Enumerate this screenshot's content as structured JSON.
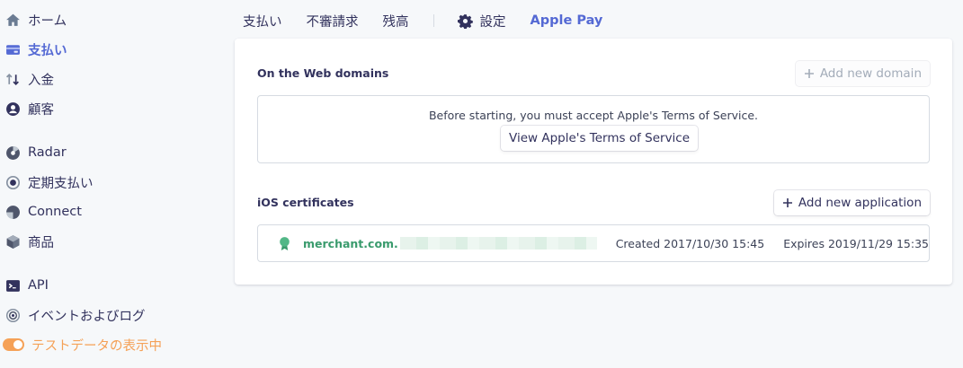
{
  "sidebar": {
    "items": [
      {
        "label": "ホーム",
        "icon": "home-icon"
      },
      {
        "label": "支払い",
        "icon": "payments-icon",
        "active": true
      },
      {
        "label": "入金",
        "icon": "transfer-icon"
      },
      {
        "label": "顧客",
        "icon": "customer-icon"
      },
      {
        "label": "Radar",
        "icon": "radar-icon"
      },
      {
        "label": "定期支払い",
        "icon": "subscription-icon"
      },
      {
        "label": "Connect",
        "icon": "connect-icon"
      },
      {
        "label": "商品",
        "icon": "product-icon"
      },
      {
        "label": "API",
        "icon": "terminal-icon"
      },
      {
        "label": "イベントおよびログ",
        "icon": "events-icon"
      }
    ],
    "test_mode": {
      "label": "テストデータの表示中",
      "icon": "toggle-icon",
      "on": true
    }
  },
  "tabs": [
    {
      "label": "支払い"
    },
    {
      "label": "不審請求"
    },
    {
      "label": "残高"
    },
    {
      "label": "設定",
      "icon": "gear-icon"
    },
    {
      "label": "Apple Pay",
      "active": true
    }
  ],
  "web_domains": {
    "title": "On the Web domains",
    "add_button": "Add new domain",
    "notice": "Before starting, you must accept Apple's Terms of Service.",
    "terms_button": "View Apple's Terms of Service"
  },
  "ios_certificates": {
    "title": "iOS certificates",
    "add_button": "Add new application",
    "certificates": [
      {
        "name": "merchant.com.",
        "created": "Created 2017/10/30 15:45",
        "expires": "Expires 2019/11/29 15:35"
      }
    ]
  },
  "colors": {
    "accent": "#5469d4",
    "text": "#32325d",
    "success": "#3a9b6d",
    "test_mode": "#f5a157",
    "background": "#f6f8fa"
  }
}
